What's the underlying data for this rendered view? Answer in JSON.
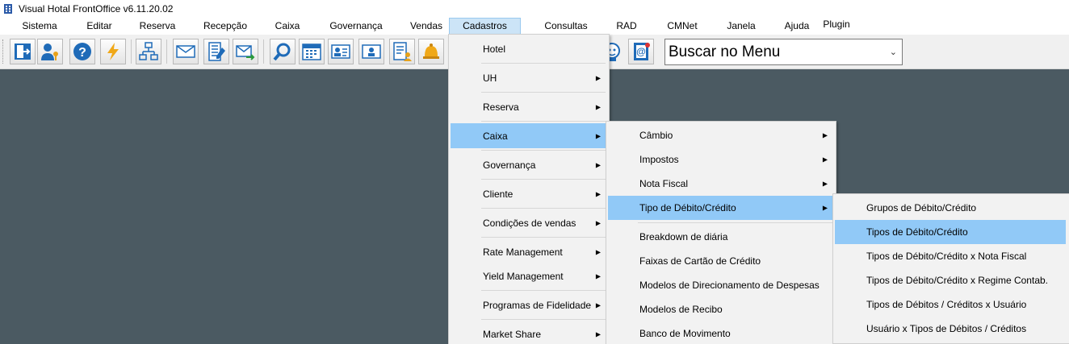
{
  "window": {
    "title": "Visual Hotal FrontOffice v6.11.20.02"
  },
  "menubar": {
    "items": [
      "Sistema",
      "Editar",
      "Reserva",
      "Recepção",
      "Caixa",
      "Governança",
      "Vendas",
      "Cadastros",
      "Consultas",
      "RAD",
      "CMNet",
      "Janela",
      "Ajuda",
      "Plugin"
    ],
    "active": "Cadastros"
  },
  "toolbar": {
    "icons": [
      "exit-door-icon",
      "user-key-icon",
      "help-icon",
      "lightning-icon",
      "org-chart-icon",
      "mail-icon",
      "building-calc-icon",
      "mail-forward-icon",
      "search-icon",
      "calendar-icon",
      "guest-card-icon",
      "guest-card-alt-icon",
      "checklist-user-icon",
      "bell-icon",
      "robot-icon",
      "email-book-icon"
    ]
  },
  "search": {
    "value": "Buscar no Menu"
  },
  "menu_cadastros": {
    "items": [
      "Hotel",
      "UH",
      "Reserva",
      "Caixa",
      "Governança",
      "Cliente",
      "Condições de vendas",
      "Rate Management",
      "Yield Management",
      "Programas de Fidelidade",
      "Market Share"
    ]
  },
  "menu_caixa": {
    "items": [
      "Câmbio",
      "Impostos",
      "Nota Fiscal",
      "Tipo de Débito/Crédito",
      "Breakdown de diária",
      "Faixas de Cartão de Crédito",
      "Modelos de Direcionamento de Despesas",
      "Modelos de Recibo",
      "Banco de Movimento"
    ]
  },
  "menu_tipo": {
    "items": [
      "Grupos de Débito/Crédito",
      "Tipos de Débito/Crédito",
      "Tipos de Débito/Crédito x Nota Fiscal",
      "Tipos de Débito/Crédito x Regime Contab.",
      "Tipos de Débitos / Créditos x Usuário",
      "Usuário x Tipos de Débitos / Créditos"
    ]
  },
  "colors": {
    "highlight": "#91c9f7",
    "background": "#4b5a62",
    "menu_active": "#cce4f7"
  }
}
